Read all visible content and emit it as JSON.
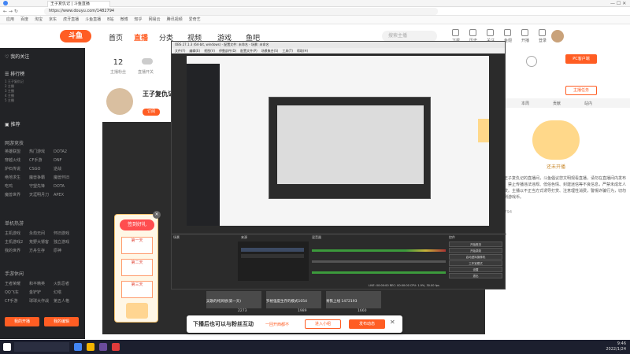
{
  "browser": {
    "tab_title": "王子复仇记 | 斗鱼直播",
    "url": "https://www.douyu.com/1482794",
    "bookmarks": [
      "应用",
      "百度",
      "淘宝",
      "京东",
      "虎牙直播",
      "斗鱼直播",
      "B站",
      "微博",
      "知乎",
      "网易云",
      "腾讯视频",
      "爱奇艺"
    ]
  },
  "topnav": {
    "logo": "斗鱼",
    "links": [
      "首页",
      "直播",
      "分类",
      "视频",
      "游戏",
      "鱼吧"
    ],
    "search_placeholder": "搜索主播",
    "icons": [
      "下载",
      "历史",
      "关注",
      "鱼翅",
      "开播",
      "登录"
    ]
  },
  "sidebar": {
    "my_follow": "我的关注",
    "ranking": "排行榜",
    "recommend": "推荐",
    "section_online": "网游竞技",
    "online_games": [
      "英雄联盟",
      "热门游戏",
      "DOTA2",
      "穿越火线",
      "CF手游",
      "DNF",
      "炉石传说",
      "CSGO",
      "逆战",
      "绝地求生",
      "魔兽争霸",
      "魔兽怀旧",
      "吃鸡",
      "守望先锋",
      "DOTA",
      "魔兽世界",
      "天涯明月刀",
      "APEX"
    ],
    "section_single": "单机热游",
    "single_games": [
      "主机游戏",
      "永劫无间",
      "怀旧游戏",
      "主机游戏2",
      "荒野大镖客",
      "独立游戏",
      "我的世界",
      "方舟生存",
      "原神"
    ],
    "section_mobile": "手游休闲",
    "mobile_games": [
      "王者荣耀",
      "和平精英",
      "火影忍者",
      "QQ飞车",
      "金铲铲",
      "幻塔",
      "CF手游",
      "球球大作战",
      "第五人格"
    ],
    "btn_open": "我的开播",
    "btn_edit": "我的编辑"
  },
  "room": {
    "followers": "12",
    "follow_label": "主播粉丝",
    "toggle_label": "直播开关",
    "streamer_name": "王子复仇记",
    "tag": "订阅",
    "pc_client": "PC客户端",
    "task_label": "主播任务",
    "tabs": [
      "主播任务",
      "本周",
      "贡献",
      "站内"
    ],
    "notice_title": "主播任务",
    "notice": "欢迎来到王子复仇记的直播间，斗鱼倡议您文明观看直播，请勿在直播间内发布违规内容，禁止传播违法违规、低俗色情、封建迷信等不良信息，严禁未成年人直播或打赏。主播以不正当方式诱导打赏、注意理性消费，警惕诈骗行为，切勿购买私利刷游戏币。",
    "slogan": "还未开播",
    "ip_value": "IP: 1482794"
  },
  "checkin": {
    "title": "签到好礼",
    "day1": "第一天",
    "day2": "第二天",
    "day3": "第三天"
  },
  "obs": {
    "title": "OBS 27.1.3 (64-bit, windows) - 配置文件: 未命名 - 场景: 未命名",
    "menu": [
      "文件(F)",
      "编辑(E)",
      "视图(V)",
      "停靠部件(D)",
      "配置文件(P)",
      "场景集合(S)",
      "工具(T)",
      "帮助(H)"
    ],
    "sources_label": "来源",
    "scene_label": "场景",
    "mixer_label": "混音器",
    "controls_label": "控件",
    "controls": [
      "开始推流",
      "开始录制",
      "启动虚拟摄像机",
      "工作室模式",
      "设置",
      "退出"
    ],
    "status": "LIVE: 00:00:00  REC: 00:00:00  CPU: 1.9%, 30.00 fps"
  },
  "thumbs": [
    {
      "title": "吴歌的纯冥想(第一天)",
      "views": "2273"
    },
    {
      "title": "罗格强度生存的模式1054",
      "views": "1989"
    },
    {
      "title": "青铁上线 1472193",
      "views": "1660"
    }
  ],
  "banner": {
    "text": "下播后也可以与粉丝互动",
    "hint": "一回开西都不",
    "btn_enter": "进入小组",
    "btn_post": "发布动态"
  },
  "taskbar": {
    "time": "9:46",
    "date": "2022/1/24"
  },
  "colors": {
    "accent": "#ff5d23",
    "sidebar_bg": "#222326",
    "obs_bg": "#2b2b2b"
  }
}
